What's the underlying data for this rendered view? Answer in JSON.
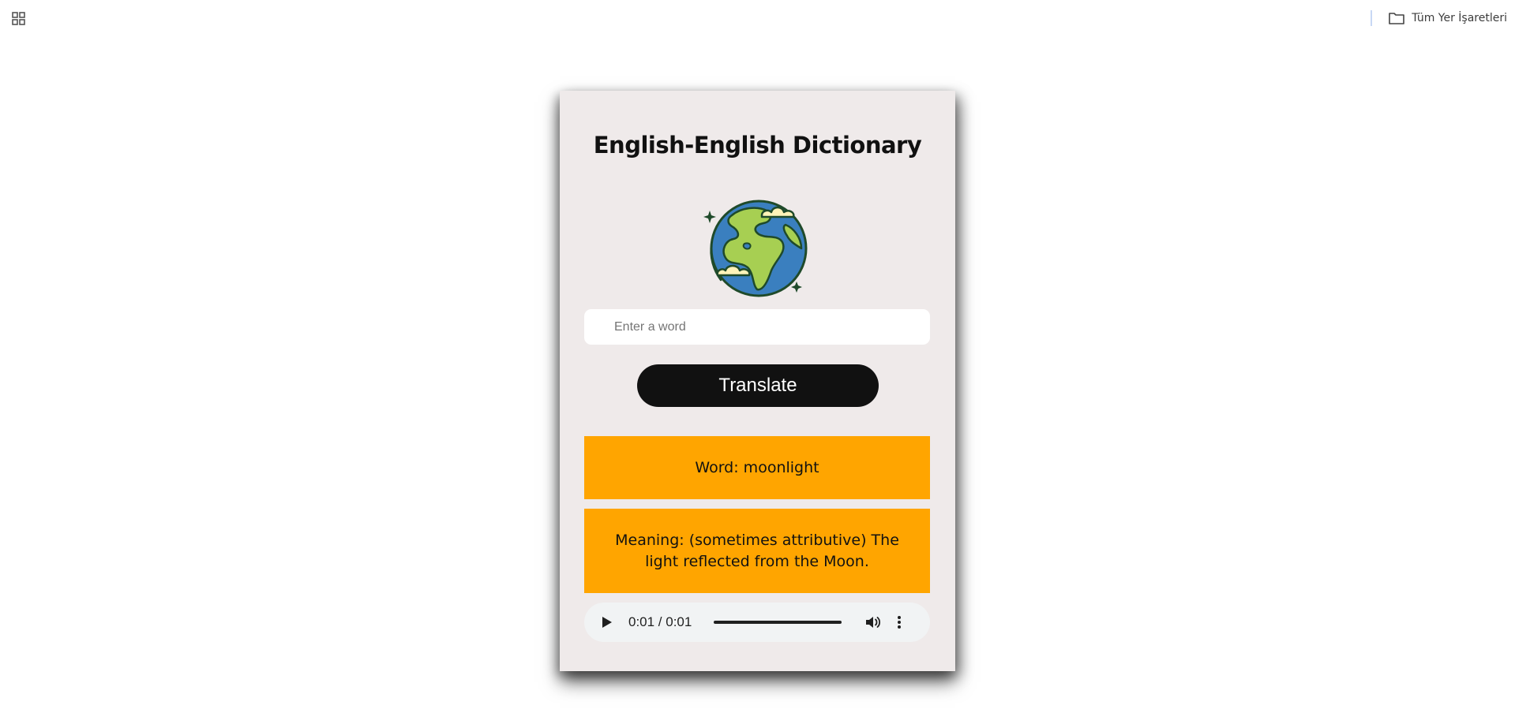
{
  "browser": {
    "apps_icon": "apps-grid-icon",
    "bookmarks_folder_icon": "folder-icon",
    "all_bookmarks_label": "Tüm Yer İşaretleri"
  },
  "app": {
    "title": "English-English Dictionary",
    "logo_icon": "globe-icon",
    "search": {
      "placeholder": "Enter a word",
      "value": ""
    },
    "translate_label": "Translate",
    "result": {
      "word_text": "Word: moonlight",
      "meaning_text": "Meaning: (sometimes attributive) The light reflected from the Moon."
    },
    "audio": {
      "time_text": "0:01 / 0:01",
      "progress": 1.0
    }
  },
  "colors": {
    "card_background": "#efeaea",
    "result_background": "#ffa500",
    "button_background": "#111111"
  }
}
